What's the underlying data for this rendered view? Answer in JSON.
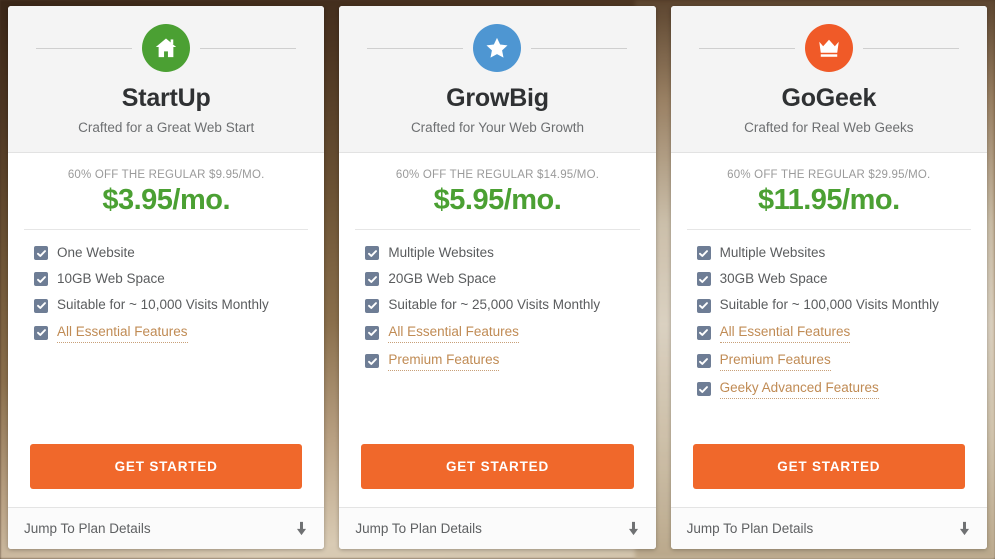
{
  "plans": [
    {
      "id": "startup",
      "name": "StartUp",
      "tagline": "Crafted for a Great Web Start",
      "icon": "home-icon",
      "icon_color": "#4ba033",
      "price_regular": "60% OFF THE REGULAR $9.95/MO.",
      "price_now": "$3.95/mo.",
      "features": [
        {
          "label": "One Website",
          "link": false
        },
        {
          "label": "10GB Web Space",
          "link": false
        },
        {
          "label": "Suitable for ~ 10,000 Visits Monthly",
          "link": false
        },
        {
          "label": "All Essential Features",
          "link": true
        }
      ],
      "cta_label": "GET STARTED",
      "footer_label": "Jump To Plan Details"
    },
    {
      "id": "growbig",
      "name": "GrowBig",
      "tagline": "Crafted for Your Web Growth",
      "icon": "star-icon",
      "icon_color": "#4e96d2",
      "price_regular": "60% OFF THE REGULAR $14.95/MO.",
      "price_now": "$5.95/mo.",
      "features": [
        {
          "label": "Multiple Websites",
          "link": false
        },
        {
          "label": "20GB Web Space",
          "link": false
        },
        {
          "label": "Suitable for ~ 25,000 Visits Monthly",
          "link": false
        },
        {
          "label": "All Essential Features",
          "link": true
        },
        {
          "label": "Premium Features",
          "link": true
        }
      ],
      "cta_label": "GET STARTED",
      "footer_label": "Jump To Plan Details"
    },
    {
      "id": "gogeek",
      "name": "GoGeek",
      "tagline": "Crafted for Real Web Geeks",
      "icon": "crown-icon",
      "icon_color": "#f05a28",
      "price_regular": "60% OFF THE REGULAR $29.95/MO.",
      "price_now": "$11.95/mo.",
      "features": [
        {
          "label": "Multiple Websites",
          "link": false
        },
        {
          "label": "30GB Web Space",
          "link": false
        },
        {
          "label": "Suitable for ~ 100,000 Visits Monthly",
          "link": false
        },
        {
          "label": "All Essential Features",
          "link": true
        },
        {
          "label": "Premium Features",
          "link": true
        },
        {
          "label": "Geeky Advanced Features",
          "link": true
        }
      ],
      "cta_label": "GET STARTED",
      "footer_label": "Jump To Plan Details"
    }
  ],
  "theme": {
    "cta_color": "#f0682b",
    "price_color": "#4ba033",
    "checkbox_color": "#6e7d95",
    "link_color": "#c08b54",
    "header_bg": "#f4f4f4"
  }
}
